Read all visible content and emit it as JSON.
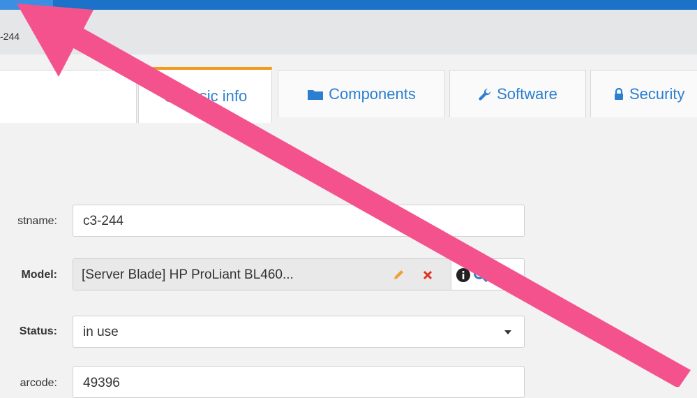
{
  "breadcrumb": {
    "text": "-244"
  },
  "tabs": [
    {
      "label": "Basic info",
      "icon": "info-icon"
    },
    {
      "label": "Components",
      "icon": "folder-icon"
    },
    {
      "label": "Software",
      "icon": "wrench-icon"
    },
    {
      "label": "Security",
      "icon": "lock-icon"
    }
  ],
  "form": {
    "hostname": {
      "label": "stname:",
      "value": "c3-244"
    },
    "model": {
      "label": "Model:",
      "value": "[Server Blade] HP ProLiant BL460..."
    },
    "status": {
      "label": "Status:",
      "value": "in use"
    },
    "barcode": {
      "label": "arcode:",
      "value": "49396"
    }
  },
  "colors": {
    "topbar": "#1c72c9",
    "active_tab_accent": "#f39b1e",
    "tab_text": "#2c7fd0",
    "annotation_arrow": "#f4528d"
  }
}
